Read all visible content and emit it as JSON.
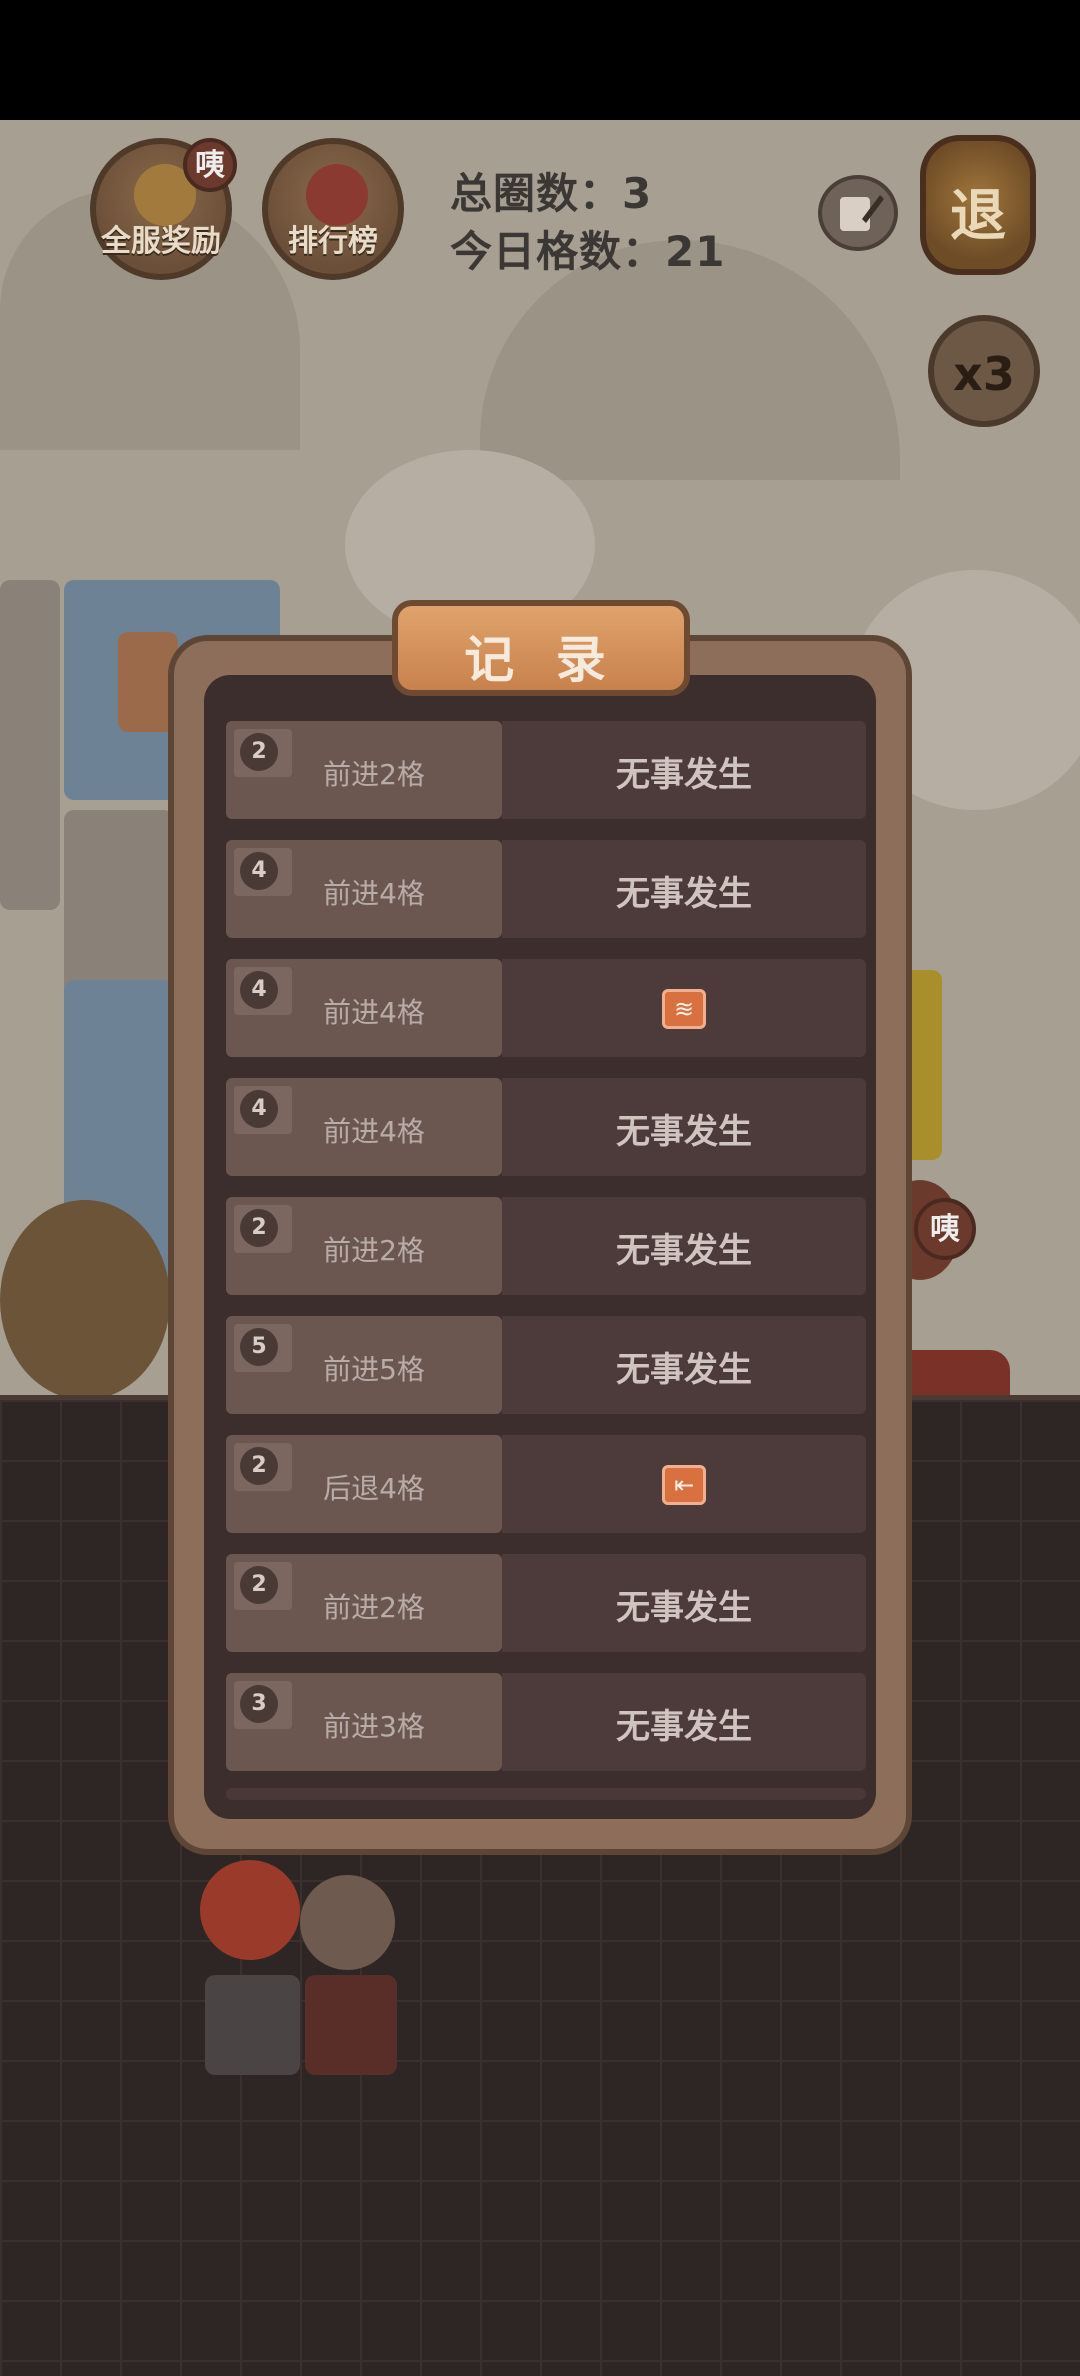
{
  "hud": {
    "server_reward_label": "全服奖励",
    "server_reward_badge": "咦",
    "leaderboard_label": "排行榜",
    "total_rounds_label": "总圈数：",
    "total_rounds_value": "3",
    "today_cells_label": "今日格数：",
    "today_cells_value": "21",
    "exit_label": "退",
    "speed_label": "x3",
    "side_badge": "咦"
  },
  "dialog": {
    "title": "记 录",
    "records": [
      {
        "dice": "2",
        "move": "前进2格",
        "result": "无事发生",
        "icon": null
      },
      {
        "dice": "4",
        "move": "前进4格",
        "result": "无事发生",
        "icon": null
      },
      {
        "dice": "4",
        "move": "前进4格",
        "result": "",
        "icon": "wave-event-icon",
        "icon_glyph": "≋"
      },
      {
        "dice": "4",
        "move": "前进4格",
        "result": "无事发生",
        "icon": null
      },
      {
        "dice": "2",
        "move": "前进2格",
        "result": "无事发生",
        "icon": null
      },
      {
        "dice": "5",
        "move": "前进5格",
        "result": "无事发生",
        "icon": null
      },
      {
        "dice": "2",
        "move": "后退4格",
        "result": "",
        "icon": "runner-event-icon",
        "icon_glyph": "⇤"
      },
      {
        "dice": "2",
        "move": "前进2格",
        "result": "无事发生",
        "icon": null
      },
      {
        "dice": "3",
        "move": "前进3格",
        "result": "无事发生",
        "icon": null
      }
    ]
  },
  "colors": {
    "accent": "#d8874f",
    "panel": "#3c2e2d",
    "row_left": "#6c5650",
    "row_right": "#4d3a3a"
  }
}
